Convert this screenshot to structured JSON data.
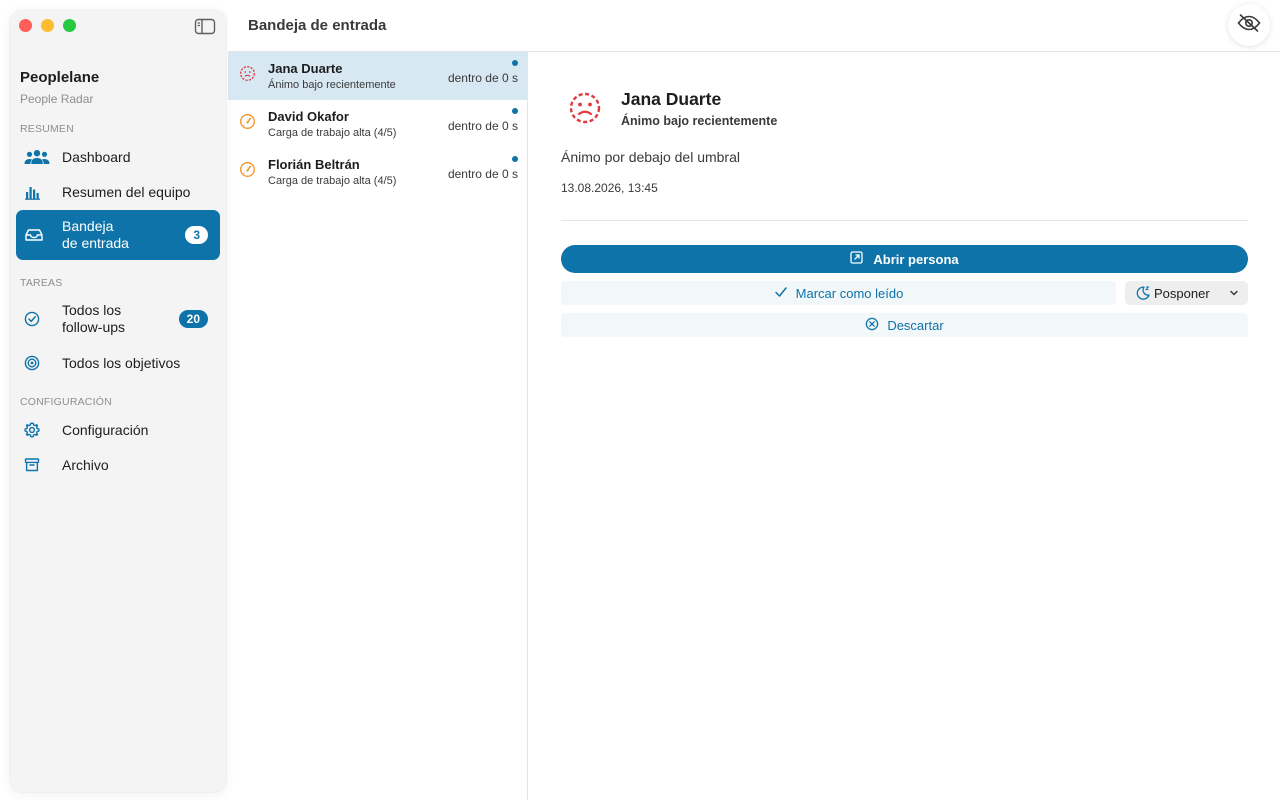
{
  "sidebar": {
    "app_name": "Peoplelane",
    "app_subtitle": "People Radar",
    "sections": {
      "resumen": "RESUMEN",
      "tareas": "TAREAS",
      "configuracion": "CONFIGURACIÓN"
    },
    "items": [
      {
        "label": "Dashboard",
        "icon": "people-icon"
      },
      {
        "label": "Resumen del equipo",
        "icon": "bar-chart-icon"
      },
      {
        "label": "Bandeja\nde entrada",
        "icon": "tray-icon",
        "badge": "3",
        "active": true
      },
      {
        "label": "Todos los\nfollow-ups",
        "icon": "checkmark-circle-icon",
        "badge": "20"
      },
      {
        "label": "Todos los objetivos",
        "icon": "target-icon"
      },
      {
        "label": "Configuración",
        "icon": "gear-icon"
      },
      {
        "label": "Archivo",
        "icon": "archive-box-icon"
      }
    ]
  },
  "header": {
    "title": "Bandeja de entrada",
    "eye_icon": "eye-slash-icon"
  },
  "inbox": {
    "rows": [
      {
        "name": "Jana Duarte",
        "subtitle": "Ánimo bajo recientemente",
        "time": "dentro de 0 s",
        "icon": "mood-face-icon",
        "icon_color": "#e0393e",
        "selected": true
      },
      {
        "name": "David Okafor",
        "subtitle": "Carga de trabajo alta (4/5)",
        "time": "dentro de 0 s",
        "icon": "gauge-icon",
        "icon_color": "#f0932b",
        "selected": false
      },
      {
        "name": "Florián Beltrán",
        "subtitle": "Carga de trabajo alta (4/5)",
        "time": "dentro de 0 s",
        "icon": "gauge-icon",
        "icon_color": "#f0932b",
        "selected": false
      }
    ]
  },
  "detail": {
    "name": "Jana Duarte",
    "subtitle": "Ánimo bajo recientemente",
    "message": "Ánimo por debajo del umbral",
    "date": "13.08.2026, 13:45",
    "open_person": "Abrir persona",
    "mark_read": "Marcar como leído",
    "postpone": "Posponer",
    "dismiss": "Descartar"
  },
  "colors": {
    "accent": "#0e73a8",
    "mood_red": "#e0393e",
    "workload_orange": "#f0932b"
  }
}
